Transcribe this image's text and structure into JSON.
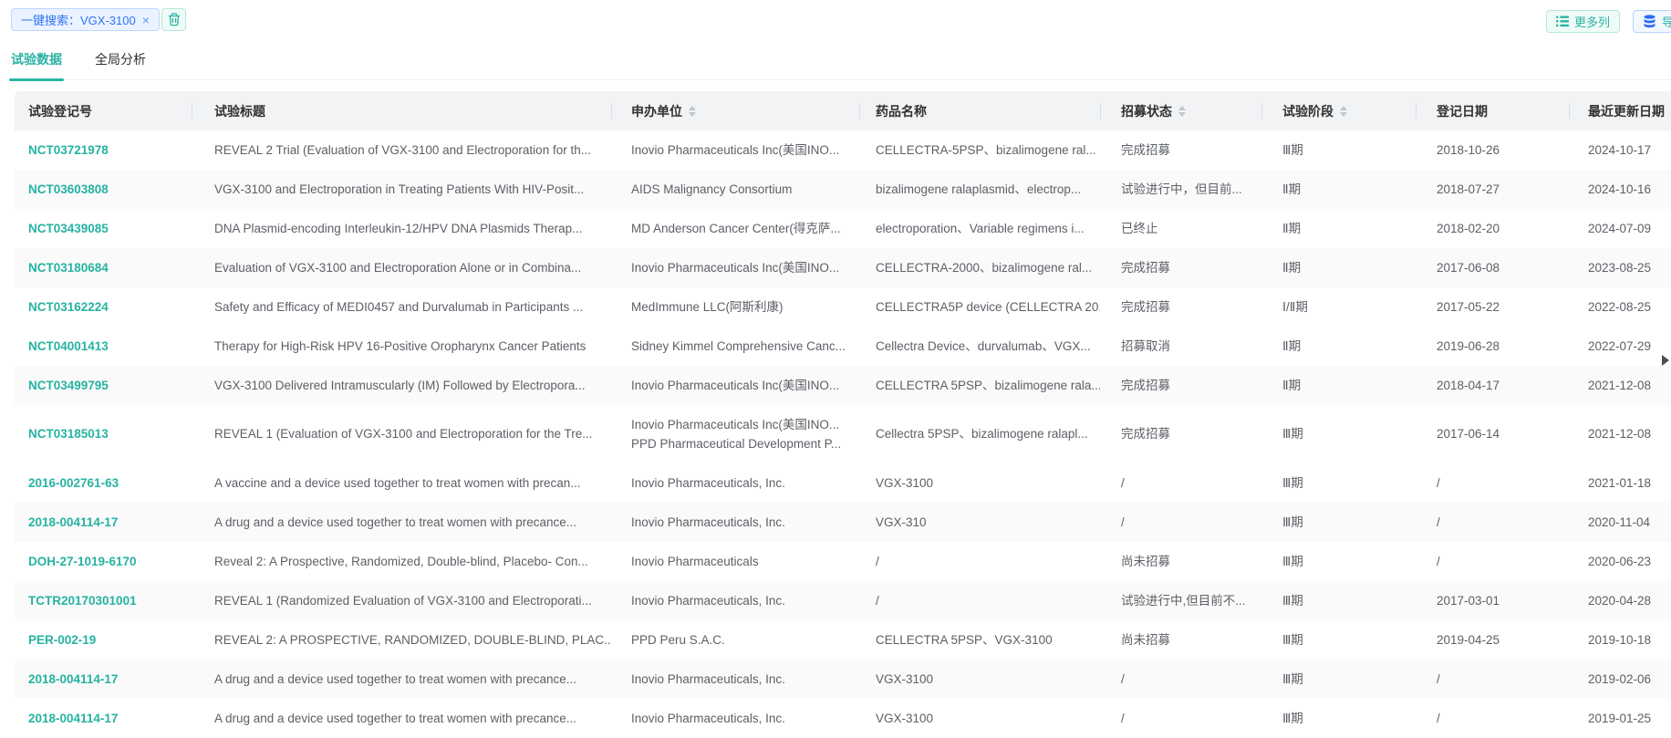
{
  "toolbar": {
    "search_tag_label": "一键搜索：VGX-3100",
    "search_tag_close": "×",
    "more_columns_label": "更多列",
    "export_label": "导出"
  },
  "tabs": [
    {
      "label": "试验数据",
      "active": true
    },
    {
      "label": "全局分析",
      "active": false
    }
  ],
  "colors": {
    "accent_teal": "#2ab3a3",
    "link_teal": "#26b3a2",
    "tag_blue": "#2f74f5",
    "export_icon_blue": "#2d6cf0",
    "header_bg": "#f2f3f5",
    "stripe_bg": "#fafafa",
    "body_text": "#5c6066"
  },
  "table": {
    "columns": [
      {
        "label": "试验登记号",
        "sortable": false
      },
      {
        "label": "试验标题",
        "sortable": false
      },
      {
        "label": "申办单位",
        "sortable": true
      },
      {
        "label": "药品名称",
        "sortable": false
      },
      {
        "label": "招募状态",
        "sortable": true
      },
      {
        "label": "试验阶段",
        "sortable": true
      },
      {
        "label": "登记日期",
        "sortable": false
      },
      {
        "label": "最近更新日期",
        "sortable": false
      }
    ],
    "rows": [
      {
        "id": "NCT03721978",
        "title": "REVEAL 2 Trial (Evaluation of VGX-3100 and Electroporation for th...",
        "sponsor": [
          "Inovio Pharmaceuticals Inc(美国INO..."
        ],
        "drug": "CELLECTRA-5PSP、bizalimogene ral...",
        "status": "完成招募",
        "phase": "Ⅲ期",
        "reg_date": "2018-10-26",
        "update_date": "2024-10-17",
        "striped": false
      },
      {
        "id": "NCT03603808",
        "title": "VGX-3100 and Electroporation in Treating Patients With HIV-Posit...",
        "sponsor": [
          "AIDS Malignancy Consortium"
        ],
        "drug": "bizalimogene ralaplasmid、electrop...",
        "status": "试验进行中，但目前...",
        "phase": "Ⅱ期",
        "reg_date": "2018-07-27",
        "update_date": "2024-10-16",
        "striped": true
      },
      {
        "id": "NCT03439085",
        "title": "DNA Plasmid-encoding Interleukin-12/HPV DNA Plasmids Therap...",
        "sponsor": [
          "MD Anderson Cancer Center(得克萨..."
        ],
        "drug": "electroporation、Variable regimens i...",
        "status": "已终止",
        "phase": "Ⅱ期",
        "reg_date": "2018-02-20",
        "update_date": "2024-07-09",
        "striped": false
      },
      {
        "id": "NCT03180684",
        "title": "Evaluation of VGX-3100 and Electroporation Alone or in Combina...",
        "sponsor": [
          "Inovio Pharmaceuticals Inc(美国INO..."
        ],
        "drug": "CELLECTRA-2000、bizalimogene ral...",
        "status": "完成招募",
        "phase": "Ⅱ期",
        "reg_date": "2017-06-08",
        "update_date": "2023-08-25",
        "striped": true
      },
      {
        "id": "NCT03162224",
        "title": "Safety and Efficacy of MEDI0457 and Durvalumab in Participants ...",
        "sponsor": [
          "MedImmune LLC(阿斯利康)"
        ],
        "drug": "CELLECTRA5P device (CELLECTRA 20...",
        "status": "完成招募",
        "phase": "Ⅰ/Ⅱ期",
        "reg_date": "2017-05-22",
        "update_date": "2022-08-25",
        "striped": false
      },
      {
        "id": "NCT04001413",
        "title": "Therapy for High-Risk HPV 16-Positive Oropharynx Cancer Patients",
        "sponsor": [
          "Sidney Kimmel Comprehensive Canc..."
        ],
        "drug": "Cellectra Device、durvalumab、VGX...",
        "status": "招募取消",
        "phase": "Ⅱ期",
        "reg_date": "2019-06-28",
        "update_date": "2022-07-29",
        "striped": false
      },
      {
        "id": "NCT03499795",
        "title": "VGX-3100 Delivered Intramuscularly (IM) Followed by Electropora...",
        "sponsor": [
          "Inovio Pharmaceuticals Inc(美国INO..."
        ],
        "drug": "CELLECTRA 5PSP、bizalimogene rala...",
        "status": "完成招募",
        "phase": "Ⅱ期",
        "reg_date": "2018-04-17",
        "update_date": "2021-12-08",
        "striped": true
      },
      {
        "id": "NCT03185013",
        "title": "REVEAL 1 (Evaluation of VGX-3100 and Electroporation for the Tre...",
        "sponsor": [
          "Inovio Pharmaceuticals Inc(美国INO...",
          "PPD Pharmaceutical Development P..."
        ],
        "drug": "Cellectra 5PSP、bizalimogene ralapl...",
        "status": "完成招募",
        "phase": "Ⅲ期",
        "reg_date": "2017-06-14",
        "update_date": "2021-12-08",
        "striped": false
      },
      {
        "id": "2016-002761-63",
        "title": "A vaccine and a device used together to treat women with precan...",
        "sponsor": [
          "Inovio Pharmaceuticals, Inc."
        ],
        "drug": "VGX-3100",
        "status": "/",
        "phase": "Ⅲ期",
        "reg_date": "/",
        "update_date": "2021-01-18",
        "striped": false
      },
      {
        "id": "2018-004114-17",
        "title": "A drug and a device used together to treat women with precance...",
        "sponsor": [
          "Inovio Pharmaceuticals, Inc."
        ],
        "drug": "VGX-310",
        "status": "/",
        "phase": "Ⅲ期",
        "reg_date": "/",
        "update_date": "2020-11-04",
        "striped": true
      },
      {
        "id": "DOH-27-1019-6170",
        "title": "Reveal 2: A Prospective, Randomized, Double-blind, Placebo- Con...",
        "sponsor": [
          "Inovio Pharmaceuticals"
        ],
        "drug": "/",
        "status": "尚未招募",
        "phase": "Ⅲ期",
        "reg_date": "/",
        "update_date": "2020-06-23",
        "striped": false
      },
      {
        "id": "TCTR20170301001",
        "title": "REVEAL 1 (Randomized Evaluation of VGX-3100 and Electroporati...",
        "sponsor": [
          "Inovio Pharmaceuticals, Inc."
        ],
        "drug": "/",
        "status": "试验进行中,但目前不...",
        "phase": "Ⅲ期",
        "reg_date": "2017-03-01",
        "update_date": "2020-04-28",
        "striped": true
      },
      {
        "id": "PER-002-19",
        "title": "REVEAL 2: A PROSPECTIVE, RANDOMIZED, DOUBLE-BLIND, PLAC...",
        "sponsor": [
          "PPD Peru S.A.C."
        ],
        "drug": "CELLECTRA 5PSP、VGX-3100",
        "status": "尚未招募",
        "phase": "Ⅲ期",
        "reg_date": "2019-04-25",
        "update_date": "2019-10-18",
        "striped": false
      },
      {
        "id": "2018-004114-17",
        "title": "A drug and a device used together to treat women with precance...",
        "sponsor": [
          "Inovio Pharmaceuticals, Inc."
        ],
        "drug": "VGX-3100",
        "status": "/",
        "phase": "Ⅲ期",
        "reg_date": "/",
        "update_date": "2019-02-06",
        "striped": true
      },
      {
        "id": "2018-004114-17",
        "title": "A drug and a device used together to treat women with precance...",
        "sponsor": [
          "Inovio Pharmaceuticals, Inc."
        ],
        "drug": "VGX-3100",
        "status": "/",
        "phase": "Ⅲ期",
        "reg_date": "/",
        "update_date": "2019-01-25",
        "striped": false
      }
    ]
  }
}
